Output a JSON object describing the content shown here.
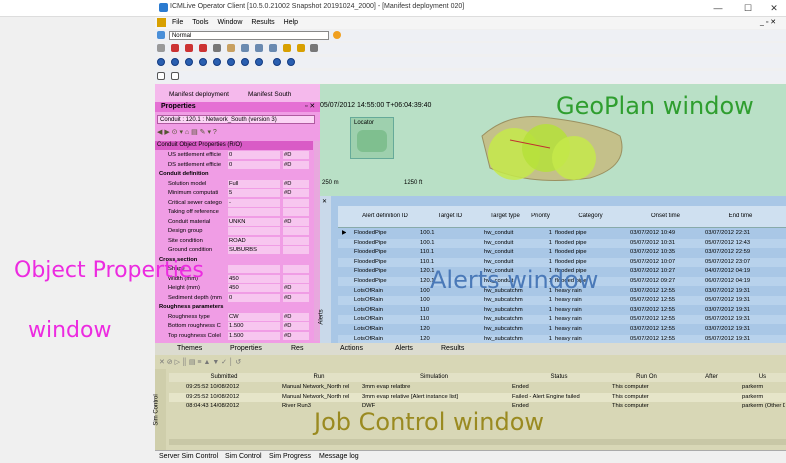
{
  "app": {
    "title": "ICMLive Operator Client [10.5.0.21002 Snapshot 20191024_2000] - [Manifest deployment 020]"
  },
  "menu": [
    "File",
    "Tools",
    "Window",
    "Results",
    "Help"
  ],
  "toolbar": {
    "scheme_combo": "Normal"
  },
  "tabs_top": [
    "Manifest deployment",
    "Manifest South"
  ],
  "properties": {
    "title": "Properties",
    "conduit_combo": "Conduit : 120.1 : Network_South (version 3)",
    "section_header": "Conduit Object Properties (R/O)",
    "rows": [
      {
        "label": "US settlement efficie",
        "value": "0",
        "flag": "#D"
      },
      {
        "label": "DS settlement efficie",
        "value": "0",
        "flag": "#D"
      },
      {
        "label": "Conduit definition",
        "value": "",
        "flag": "",
        "group": true
      },
      {
        "label": "Solution model",
        "value": "Full",
        "flag": "#D"
      },
      {
        "label": "Minimum computati",
        "value": "5",
        "flag": "#D"
      },
      {
        "label": "Critical sewer catego",
        "value": "-",
        "flag": ""
      },
      {
        "label": "Taking off reference",
        "value": "",
        "flag": ""
      },
      {
        "label": "Conduit material",
        "value": "UNKN",
        "flag": "#D"
      },
      {
        "label": "Design group",
        "value": "",
        "flag": ""
      },
      {
        "label": "Site condition",
        "value": "ROAD",
        "flag": ""
      },
      {
        "label": "Ground condition",
        "value": "SUBURBS",
        "flag": ""
      },
      {
        "label": "Cross section",
        "value": "",
        "flag": "",
        "group": true
      },
      {
        "label": "Shape",
        "value": "",
        "flag": ""
      },
      {
        "label": "Width (mm)",
        "value": "450",
        "flag": ""
      },
      {
        "label": "Height (mm)",
        "value": "450",
        "flag": "#D"
      },
      {
        "label": "Sediment depth (mm",
        "value": "0",
        "flag": "#D"
      },
      {
        "label": "Roughness parameters",
        "value": "",
        "flag": "",
        "group": true
      },
      {
        "label": "Roughness type",
        "value": "CW",
        "flag": "#D"
      },
      {
        "label": "Bottom roughness C",
        "value": "1.500",
        "flag": "#D"
      },
      {
        "label": "Top roughness Colel",
        "value": "1.500",
        "flag": "#D"
      }
    ]
  },
  "geoplan": {
    "timestamp": "05/07/2012 14:55:00 T+06:04:39:40",
    "locator": "Locator",
    "scale_left": "250 m",
    "scale_right": "1250 ft"
  },
  "alerts": {
    "columns": [
      "Alert definition ID",
      "Target ID",
      "Target type",
      "Priority",
      "Category",
      "Onset time",
      "End time"
    ],
    "rows": [
      [
        "FloodedPipe",
        "100.1",
        "hw_conduit",
        "1",
        "flooded pipe",
        "03/07/2012 10:49",
        "03/07/2012 22:31"
      ],
      [
        "FloodedPipe",
        "100.1",
        "hw_conduit",
        "1",
        "flooded pipe",
        "05/07/2012 10:31",
        "05/07/2012 12:43"
      ],
      [
        "FloodedPipe",
        "110.1",
        "hw_conduit",
        "1",
        "flooded pipe",
        "03/07/2012 10:35",
        "03/07/2012 22:59"
      ],
      [
        "FloodedPipe",
        "110.1",
        "hw_conduit",
        "1",
        "flooded pipe",
        "05/07/2012 10:07",
        "05/07/2012 23:07"
      ],
      [
        "FloodedPipe",
        "120.1",
        "hw_conduit",
        "1",
        "flooded pipe",
        "03/07/2012 10:27",
        "04/07/2012 04:19"
      ],
      [
        "FloodedPipe",
        "120.1",
        "hw_conduit",
        "1",
        "flooded pipe",
        "05/07/2012 09:27",
        "06/07/2012 04:19"
      ],
      [
        "LotsOfRain",
        "100",
        "hw_subcatchm",
        "1",
        "heavy rain",
        "03/07/2012 12:55",
        "03/07/2012 19:31"
      ],
      [
        "LotsOfRain",
        "100",
        "hw_subcatchm",
        "1",
        "heavy rain",
        "05/07/2012 12:55",
        "05/07/2012 19:31"
      ],
      [
        "LotsOfRain",
        "110",
        "hw_subcatchm",
        "1",
        "heavy rain",
        "03/07/2012 12:55",
        "03/07/2012 19:31"
      ],
      [
        "LotsOfRain",
        "110",
        "hw_subcatchm",
        "1",
        "heavy rain",
        "05/07/2012 12:55",
        "05/07/2012 19:31"
      ],
      [
        "LotsOfRain",
        "120",
        "hw_subcatchm",
        "1",
        "heavy rain",
        "03/07/2012 12:55",
        "03/07/2012 19:31"
      ],
      [
        "LotsOfRain",
        "120",
        "hw_subcatchm",
        "1",
        "heavy rain",
        "05/07/2012 12:55",
        "05/07/2012 19:31"
      ]
    ],
    "side_label": "Alerts"
  },
  "bottom_tabs": [
    "Themes",
    "Properties",
    "Res",
    "Actions",
    "Alerts",
    "Results"
  ],
  "jobs": {
    "columns": [
      "Submitted",
      "Run",
      "Simulation",
      "Status",
      "Run On",
      "After",
      "Us"
    ],
    "rows": [
      [
        "09:25:52 10/08/2012",
        "Manual Network_North rel",
        "3mm evap relatbre",
        "Ended",
        "This computer",
        "",
        "parkerm"
      ],
      [
        "09:25:52 10/08/2012",
        "Manual Network_North rel",
        "3mm evap relative [Alert instance list]",
        "Failed - Alert Engine failed",
        "This computer",
        "",
        "parkerm"
      ],
      [
        "08:04:43 14/08/2012",
        "River Run3",
        "DWF",
        "Ended",
        "This computer",
        "",
        "parkerm (Other D"
      ]
    ],
    "side_label": "Sim Control"
  },
  "status_tabs": [
    "Server Sim Control",
    "Sim Control",
    "Sim Progress",
    "Message log"
  ],
  "overlays": {
    "geoplan": "GeoPlan window",
    "object_props_1": "Object Properties",
    "object_props_2": "window",
    "alerts": "Alerts window",
    "job_control": "Job Control window"
  }
}
